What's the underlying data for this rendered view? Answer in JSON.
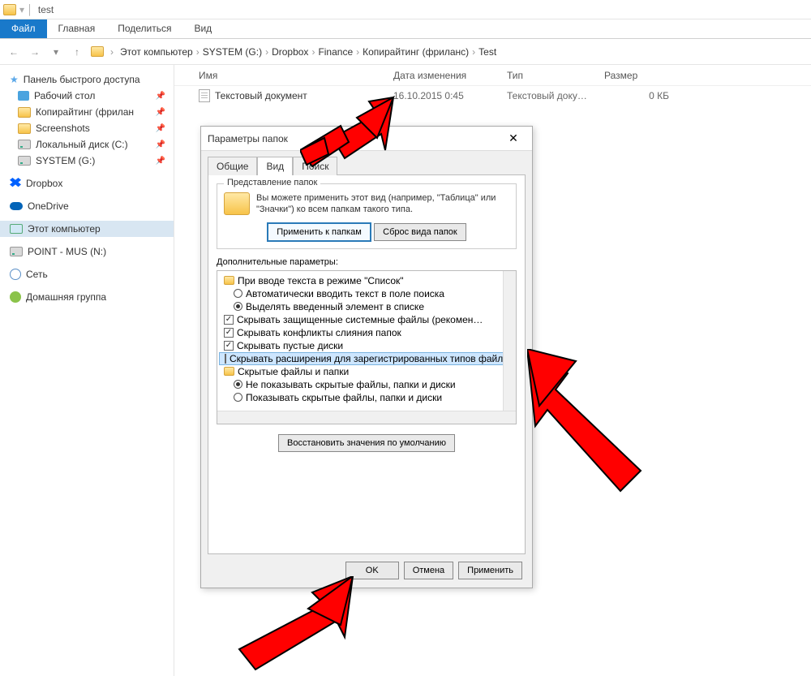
{
  "titlebar": {
    "title": "test"
  },
  "ribbon": {
    "file": "Файл",
    "tabs": [
      "Главная",
      "Поделиться",
      "Вид"
    ]
  },
  "breadcrumb": [
    "Этот компьютер",
    "SYSTEM (G:)",
    "Dropbox",
    "Finance",
    "Копирайтинг (фриланс)",
    "Test"
  ],
  "columns": {
    "name": "Имя",
    "date": "Дата изменения",
    "type": "Тип",
    "size": "Размер"
  },
  "file": {
    "name": "Текстовый документ",
    "date": "16.10.2015 0:45",
    "type": "Текстовый доку…",
    "size": "0 КБ"
  },
  "sidebar": {
    "quick": "Панель быстрого доступа",
    "items": [
      "Рабочий стол",
      "Копирайтинг (фрилан",
      "Screenshots",
      "Локальный диск (C:)",
      "SYSTEM (G:)"
    ],
    "dropbox": "Dropbox",
    "onedrive": "OneDrive",
    "thispc": "Этот компьютер",
    "point": "POINT - MUS (N:)",
    "network": "Сеть",
    "homegroup": "Домашняя группа"
  },
  "dialog": {
    "title": "Параметры папок",
    "tabs": [
      "Общие",
      "Вид",
      "Поиск"
    ],
    "group1": {
      "legend": "Представление папок",
      "text": "Вы можете применить этот вид (например, \"Таблица\" или \"Значки\") ко всем папкам такого типа.",
      "apply": "Применить к папкам",
      "reset": "Сброс вида папок"
    },
    "advanced_label": "Дополнительные параметры:",
    "tree": {
      "r0": "При вводе текста в режиме \"Список\"",
      "r1": "Автоматически вводить текст в поле поиска",
      "r2": "Выделять введенный элемент в списке",
      "r3": "Скрывать защищенные системные файлы (рекомен…",
      "r4": "Скрывать конфликты слияния папок",
      "r5": "Скрывать пустые диски",
      "r6": "Скрывать расширения для зарегистрированных типов файлов",
      "r7": "Скрытые файлы и папки",
      "r8": "Не показывать скрытые файлы, папки и диски",
      "r9": "Показывать скрытые файлы, папки и диски"
    },
    "restore": "Восстановить значения по умолчанию",
    "ok": "OK",
    "cancel": "Отмена",
    "apply": "Применить"
  }
}
